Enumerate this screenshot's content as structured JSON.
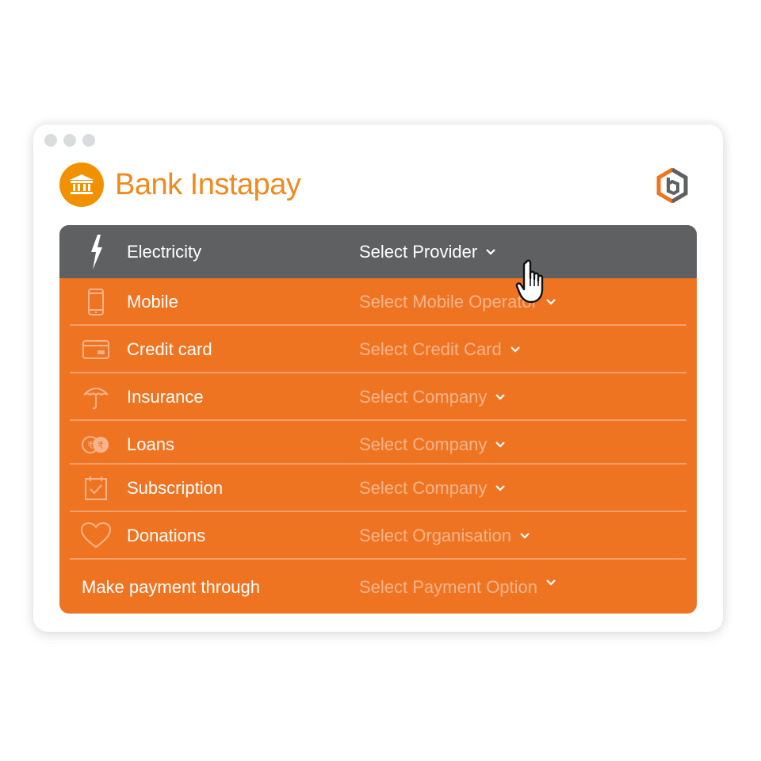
{
  "app": {
    "title": "Bank Instapay"
  },
  "colors": {
    "accent": "#ef7422",
    "active_row": "#5f6062",
    "brand_orange": "#f29100"
  },
  "rows": [
    {
      "label": "Electricity",
      "select": "Select Provider",
      "icon": "lightning-icon"
    },
    {
      "label": "Mobile",
      "select": "Select Mobile Operator",
      "icon": "phone-icon"
    },
    {
      "label": "Credit card",
      "select": "Select Credit Card",
      "icon": "credit-card-icon"
    },
    {
      "label": "Insurance",
      "select": "Select Company",
      "icon": "umbrella-icon"
    },
    {
      "label": "Loans",
      "select": "Select Company",
      "icon": "rupee-coins-icon"
    },
    {
      "label": "Subscription",
      "select": "Select Company",
      "icon": "calendar-check-icon"
    },
    {
      "label": "Donations",
      "select": "Select Organisation",
      "icon": "heart-icon"
    }
  ],
  "payment": {
    "label": "Make payment through",
    "select": "Select Payment Option"
  }
}
